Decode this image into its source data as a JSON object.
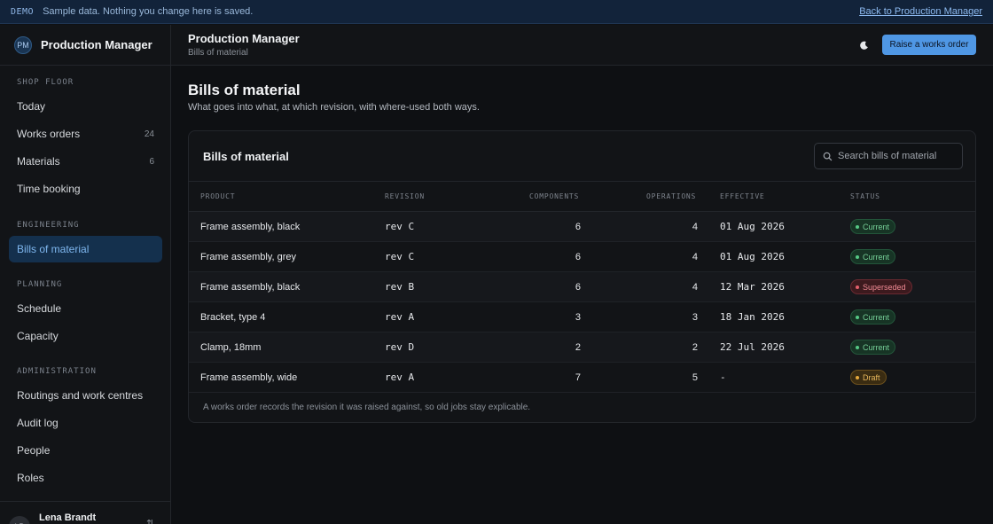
{
  "banner": {
    "tag": "DEMO",
    "message": "Sample data. Nothing you change here is saved.",
    "back_link": "Back to Production Manager"
  },
  "sidebar": {
    "brand_initials": "PM",
    "brand_name": "Production Manager",
    "sections": [
      {
        "title": "SHOP FLOOR",
        "items": [
          {
            "label": "Today",
            "count": ""
          },
          {
            "label": "Works orders",
            "count": "24"
          },
          {
            "label": "Materials",
            "count": "6"
          },
          {
            "label": "Time booking",
            "count": ""
          }
        ]
      },
      {
        "title": "ENGINEERING",
        "items": [
          {
            "label": "Bills of material",
            "count": "",
            "active": true
          }
        ]
      },
      {
        "title": "PLANNING",
        "items": [
          {
            "label": "Schedule",
            "count": ""
          },
          {
            "label": "Capacity",
            "count": ""
          }
        ]
      },
      {
        "title": "ADMINISTRATION",
        "items": [
          {
            "label": "Routings and work centres",
            "count": ""
          },
          {
            "label": "Audit log",
            "count": ""
          },
          {
            "label": "People",
            "count": ""
          },
          {
            "label": "Roles",
            "count": ""
          }
        ]
      }
    ],
    "user": {
      "initials": "LB",
      "name": "Lena Brandt"
    }
  },
  "header": {
    "title": "Production Manager",
    "breadcrumb": "Bills of material",
    "theme_icon": "moon-icon",
    "raise_button": "Raise a works order"
  },
  "page": {
    "title": "Bills of material",
    "subtitle": "What goes into what, at which revision, with where-used both ways."
  },
  "card": {
    "title": "Bills of material",
    "search_placeholder": "Search bills of material",
    "columns": [
      "PRODUCT",
      "REVISION",
      "COMPONENTS",
      "OPERATIONS",
      "EFFECTIVE",
      "STATUS"
    ],
    "rows": [
      {
        "product": "Frame assembly, black",
        "revision": "rev C",
        "components": "6",
        "operations": "4",
        "effective": "01 Aug 2026",
        "status": "Current",
        "status_kind": "current"
      },
      {
        "product": "Frame assembly, grey",
        "revision": "rev C",
        "components": "6",
        "operations": "4",
        "effective": "01 Aug 2026",
        "status": "Current",
        "status_kind": "current"
      },
      {
        "product": "Frame assembly, black",
        "revision": "rev B",
        "components": "6",
        "operations": "4",
        "effective": "12 Mar 2026",
        "status": "Superseded",
        "status_kind": "superseded"
      },
      {
        "product": "Bracket, type 4",
        "revision": "rev A",
        "components": "3",
        "operations": "3",
        "effective": "18 Jan 2026",
        "status": "Current",
        "status_kind": "current"
      },
      {
        "product": "Clamp, 18mm",
        "revision": "rev D",
        "components": "2",
        "operations": "2",
        "effective": "22 Jul 2026",
        "status": "Current",
        "status_kind": "current"
      },
      {
        "product": "Frame assembly, wide",
        "revision": "rev A",
        "components": "7",
        "operations": "5",
        "effective": "-",
        "status": "Draft",
        "status_kind": "draft"
      }
    ],
    "footnote": "A works order records the revision it was raised against, so old jobs stay explicable."
  },
  "colors": {
    "accent": "#4f97e4",
    "status_current": "#56c885",
    "status_superseded": "#e45f6c",
    "status_draft": "#e6a93c"
  }
}
